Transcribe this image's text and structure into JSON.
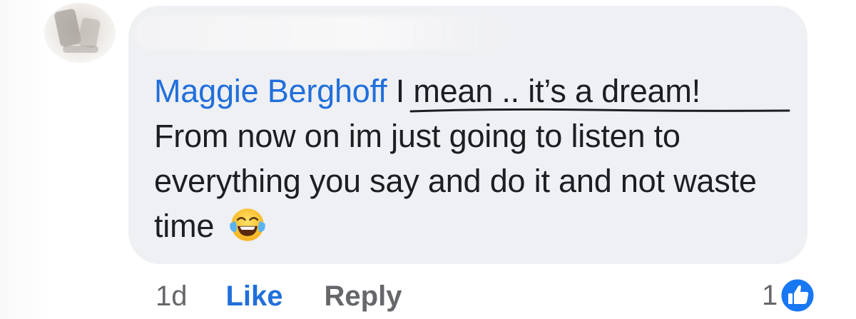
{
  "comment": {
    "author": "Maggie Berghoff",
    "text_line1_pre": " I mean .. ",
    "text_line1_underlined": "it’s a dream!",
    "text_rest": "From now on im just going to listen to everything you say and do it and not waste time",
    "emoji": "laughing-with-tears-emoji"
  },
  "actions": {
    "time": "1d",
    "like_label": "Like",
    "reply_label": "Reply"
  },
  "reactions": {
    "count": "1",
    "icon": "thumbs-up-icon",
    "badge_color": "#1877f2"
  },
  "colors": {
    "mention": "#216fdb",
    "bubble": "#eff0f3",
    "text": "#1c1e21",
    "meta": "#65676b"
  }
}
